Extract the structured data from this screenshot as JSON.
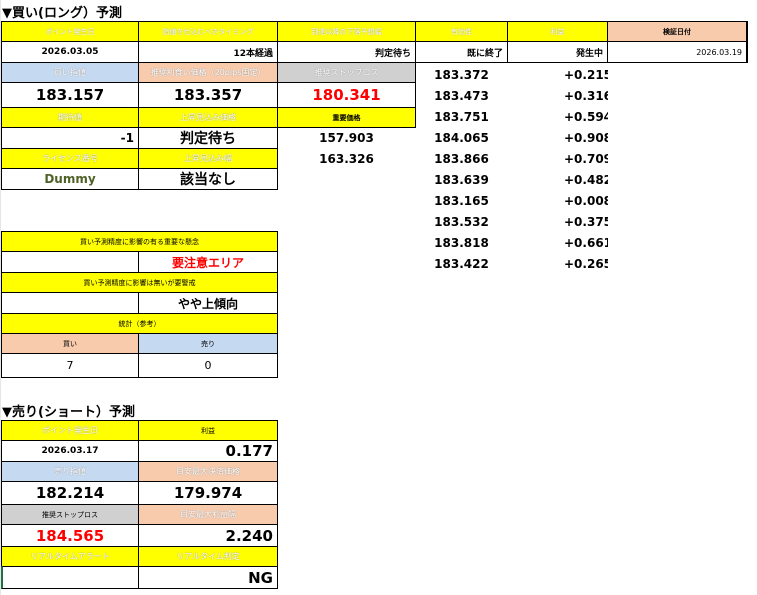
{
  "long": {
    "title": "▼買い(ロング）予測",
    "headers": [
      "ポイント発生日",
      "指値を仕込むべきタイミング",
      "到達以降の下落予想幅",
      "有効性",
      "利益",
      "検証日付"
    ],
    "values": [
      "2026.03.05",
      "12本経過",
      "判定待ち",
      "既に終了",
      "発生中",
      "2026.03.19"
    ],
    "buy_limit_label": "買い指値",
    "take_profit_label": "推奨利食い価格（20pips固定）",
    "stop_loss_label": "推奨ストップロス",
    "buy_limit": "183.157",
    "take_profit": "183.357",
    "stop_loss": "180.341",
    "expected_label": "期待値",
    "rise_price_label": "上昇見込み価格",
    "important_price_label": "重要価格",
    "expected_value": "-1",
    "rise_price_value": "判定待ち",
    "important_price_1": "157.903",
    "important_price_2": "163.326",
    "license_label": "ライセンス番号",
    "rise_width_label": "上昇見込み幅",
    "license_value": "Dummy",
    "rise_width_value": "該当なし",
    "prices": [
      "183.372",
      "183.473",
      "183.751",
      "184.065",
      "183.866",
      "183.639",
      "183.165",
      "183.532",
      "183.818",
      "183.422"
    ],
    "profits": [
      "+0.215",
      "+0.316",
      "+0.594",
      "+0.908",
      "+0.709",
      "+0.482",
      "+0.008",
      "+0.375",
      "+0.661",
      "+0.265"
    ],
    "important_factor_label": "買い予測精度に影響の有る重要な懸念",
    "important_factor_value": "要注意エリア",
    "minor_factor_label": "買い予測精度に影響は無いが要警戒",
    "minor_factor_value": "やや上傾向",
    "stats_label": "統計（参考）",
    "stats_buy_label": "買い",
    "stats_sell_label": "売り",
    "stats_buy_value": "7",
    "stats_sell_value": "0"
  },
  "short": {
    "title": "▼売り(ショート）予測",
    "point_date_label": "ポイント発生日",
    "profit_label": "利益",
    "point_date": "2026.03.17",
    "profit": "0.177",
    "sell_limit_label": "売り指値",
    "target_close_label": "目安最大決済価格",
    "sell_limit": "182.214",
    "target_close": "179.974",
    "stop_loss_label": "推奨ストップロス",
    "max_profit_label": "目安最大利益幅",
    "stop_loss": "184.565",
    "max_profit": "2.240",
    "realtime_alert_label": "リアルタイムアラート",
    "realtime_judge_label": "リアルタイム判定",
    "realtime_alert": "",
    "realtime_judge": "NG"
  }
}
